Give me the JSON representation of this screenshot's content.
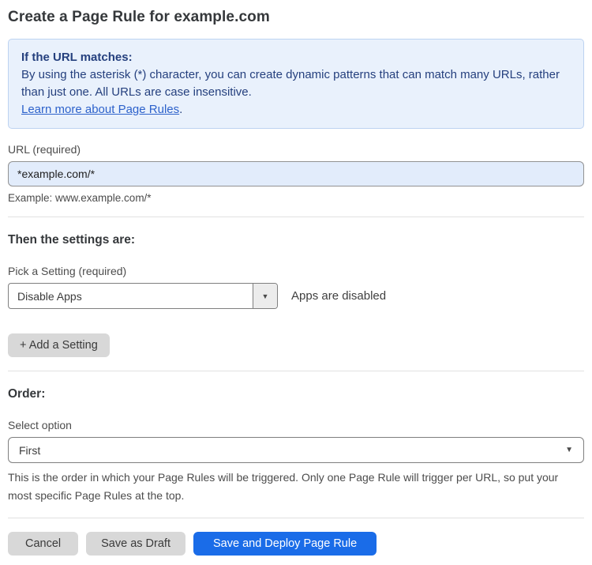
{
  "page": {
    "title": "Create a Page Rule for example.com"
  },
  "info_box": {
    "heading": "If the URL matches:",
    "body": "By using the asterisk (*) character, you can create dynamic patterns that can match many URLs, rather than just one. All URLs are case insensitive.",
    "link_label": "Learn more about Page Rules",
    "link_suffix": "."
  },
  "url_field": {
    "label": "URL (required)",
    "value": "*example.com/*",
    "helper": "Example: www.example.com/*"
  },
  "settings": {
    "heading": "Then the settings are:",
    "picker_label": "Pick a Setting (required)",
    "selected_value": "Disable Apps",
    "value_description": "Apps are disabled",
    "add_button_label": "+ Add a Setting"
  },
  "order": {
    "heading": "Order:",
    "select_label": "Select option",
    "selected_value": "First",
    "helper": "This is the order in which your Page Rules will be triggered. Only one Page Rule will trigger per URL, so put your most specific Page Rules at the top."
  },
  "actions": {
    "cancel_label": "Cancel",
    "save_draft_label": "Save as Draft",
    "save_deploy_label": "Save and Deploy Page Rule"
  },
  "icons": {
    "dropdown_arrow": "▼"
  },
  "colors": {
    "info_bg": "#e9f1fc",
    "info_border": "#bdd3f1",
    "info_text": "#25407e",
    "link": "#2d62cb",
    "input_bg": "#e2ecfb",
    "primary_button": "#1a6ce8",
    "gray_button": "#d8d8d8"
  }
}
